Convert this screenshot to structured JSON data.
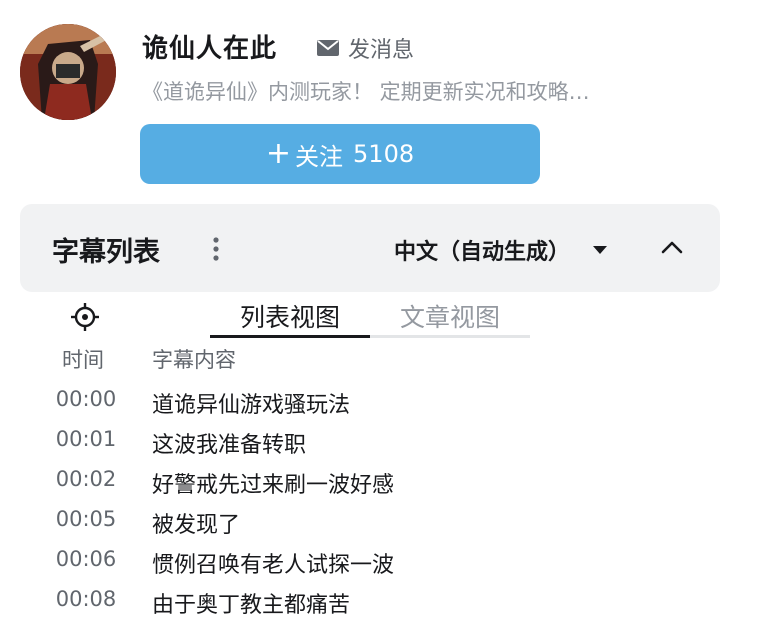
{
  "profile": {
    "username": "诡仙人在此",
    "message_label": "发消息",
    "bio": "《道诡异仙》内测玩家！ 定期更新实况和攻略…",
    "follow_label": "关注",
    "follow_count": "5108"
  },
  "subtitle_panel": {
    "title": "字幕列表",
    "language": "中文（自动生成）",
    "tabs": [
      {
        "label": "列表视图",
        "active": true
      },
      {
        "label": "文章视图",
        "active": false
      }
    ],
    "columns": {
      "time": "时间",
      "content": "字幕内容"
    },
    "rows": [
      {
        "time": "00:00",
        "text": "道诡异仙游戏骚玩法"
      },
      {
        "time": "00:01",
        "text": "这波我准备转职"
      },
      {
        "time": "00:02",
        "text": "好警戒先过来刷一波好感"
      },
      {
        "time": "00:05",
        "text": "被发现了"
      },
      {
        "time": "00:06",
        "text": "惯例召唤有老人试探一波"
      },
      {
        "time": "00:08",
        "text": "由于奥丁教主都痛苦"
      }
    ]
  },
  "icons": {
    "message": "mail-icon",
    "more": "vertical-dots-icon",
    "language_dropdown": "caret-down-icon",
    "collapse": "chevron-up-icon",
    "locate": "crosshair-icon",
    "follow": "plus-icon"
  },
  "colors": {
    "follow_button": "#56ade3",
    "panel_header_bg": "#f1f2f3",
    "active_tab": "#18191c",
    "inactive_tab": "#9499a0"
  }
}
